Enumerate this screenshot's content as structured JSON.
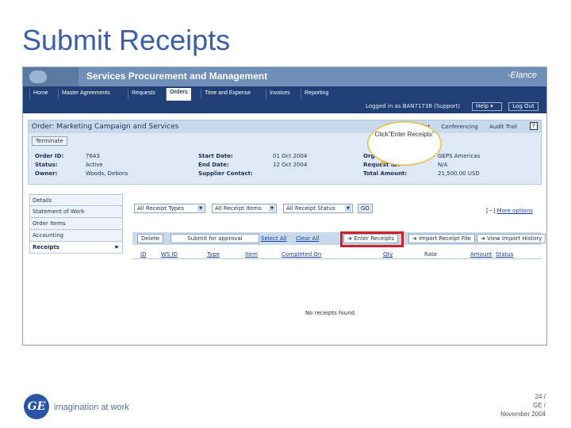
{
  "slide": {
    "title": "Submit Receipts"
  },
  "banner": {
    "app_title": "Services Procurement and Management",
    "brand": "-Elance"
  },
  "nav": {
    "tabs": [
      "Home",
      "Master Agreements",
      "Requests",
      "Orders",
      "Time and Expense",
      "Invoices",
      "Reporting"
    ],
    "active": "Orders"
  },
  "userbar": {
    "logged_in": "Logged in as BAN71738 (Support)",
    "help": "Help",
    "logout": "Log Out"
  },
  "order": {
    "title": "Order: Marketing Campaign and Services",
    "actions": [
      "Print",
      "Conferencing",
      "Audit Trail"
    ],
    "help_icon": "?",
    "terminate_label": "Terminate",
    "labels": {
      "order_id": "Order ID:",
      "status": "Status:",
      "owner": "Owner:",
      "start_date": "Start Date:",
      "end_date": "End Date:",
      "supplier_contact": "Supplier Contact:",
      "organization": "Organization:",
      "request_id": "Request ID:",
      "total_amount": "Total Amount:"
    },
    "values": {
      "order_id": "7643",
      "status": "Active",
      "owner": "Woods, Debora",
      "start_date": "01 Oct 2004",
      "end_date": "12 Oct 2004",
      "supplier_contact": "",
      "organization": "GEPS Americas",
      "request_id": "N/A",
      "total_amount": "21,500.00 USD"
    }
  },
  "sidenav": {
    "items": [
      "Details",
      "Statement of Work",
      "Order Items",
      "Accounting",
      "Receipts"
    ],
    "active": "Receipts"
  },
  "filters": {
    "receipt_types": "All Receipt Types",
    "receipt_items": "All Receipt Items",
    "receipt_status": "All Receipt Status",
    "go": "GO",
    "more_prefix": "[−]",
    "more_options": "More options"
  },
  "toolbar": {
    "delete": "Delete",
    "submit": "Submit for approval",
    "select_all": "Select All",
    "clear_all": "Clear All",
    "enter_receipts": "Enter Receipts",
    "import_file": "Import Receipt File",
    "import_history": "View Import History"
  },
  "table": {
    "columns": [
      "ID",
      "WS ID",
      "Type",
      "Item",
      "Completed On",
      "Qty",
      "Rate",
      "Amount",
      "Status"
    ],
    "empty_message": "No receipts found."
  },
  "callout": {
    "text": "Click”Enter Receipts”"
  },
  "footer": {
    "tagline": "imagination at work",
    "line1": "24 /",
    "line2": "GE /",
    "line3": "November 2004",
    "logo_text": "GE"
  },
  "colors": {
    "title_blue": "#3a5ea8",
    "nav_dark": "#1f3f75",
    "highlight_red": "#d0202a"
  }
}
